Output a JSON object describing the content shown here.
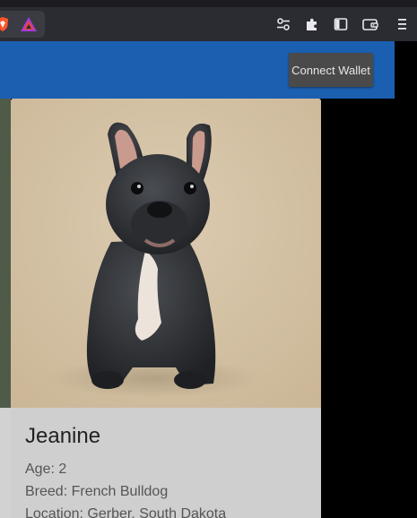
{
  "browser": {
    "icons": [
      "brave-shield-icon",
      "brave-rewards-icon",
      "settings-sliders-icon",
      "extensions-puzzle-icon",
      "sidebar-icon",
      "wallet-icon",
      "menu-icon"
    ]
  },
  "navbar": {
    "connect_label": "Connect Wallet",
    "color": "#1b5fb0"
  },
  "card": {
    "name": "Jeanine",
    "age_label": "Age:",
    "age": "2",
    "breed_label": "Breed:",
    "breed": "French Bulldog",
    "location_label": "Location:",
    "location": "Gerber, South Dakota"
  }
}
